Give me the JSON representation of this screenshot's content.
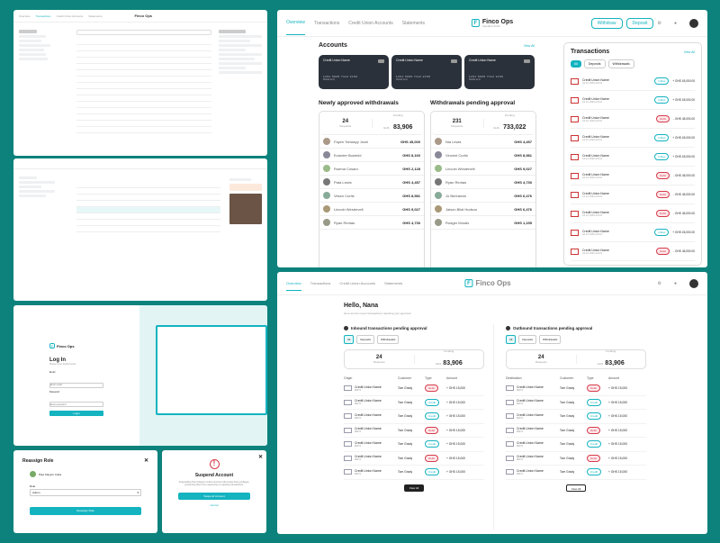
{
  "brand": {
    "name": "Finco Ops",
    "tagline": "Operations Portal"
  },
  "nav": {
    "overview": "Overview",
    "transactions": "Transactions",
    "credit_union": "Credit Union Accounts",
    "statements": "Statements"
  },
  "top_right": {
    "withdraw_label": "Withdraw",
    "deposit_label": "Deposit"
  },
  "accounts": {
    "title": "Accounts",
    "view_all": "View All",
    "cards": [
      {
        "name": "Credit Union Name",
        "number": "1251 5965 7112 2156",
        "type": "Mobile Acct"
      },
      {
        "name": "Credit Union Name",
        "number": "1251 5965 7112 2156",
        "type": "Mobile Acct"
      },
      {
        "name": "Credit Union Name",
        "number": "1251 5965 7112 2156",
        "type": "Mobile Acct"
      }
    ]
  },
  "approved": {
    "title": "Newly approved withdrawals",
    "count": "24",
    "count_label": "Requests",
    "funding_label": "Funding",
    "currency": "GHS",
    "amount": "83,906",
    "rows": [
      {
        "name": "Fayen Tobiasyy Jovel",
        "amount": "GHS 45,000"
      },
      {
        "name": "Evander Bowerld",
        "amount": "GHS 8,160"
      },
      {
        "name": "Ruema Cosaro",
        "amount": "GHS 2,128"
      },
      {
        "name": "Pata Lewis",
        "amount": "GHS 4,457"
      },
      {
        "name": "Vesen Curtis",
        "amount": "GHS 8,981"
      },
      {
        "name": "Lincoln Westervelt",
        "amount": "GHS 9,027"
      },
      {
        "name": "Ryan Rentas",
        "amount": "GHS 4,730"
      }
    ]
  },
  "pending": {
    "title": "Withdrawals pending approval",
    "count": "231",
    "count_label": "Requests",
    "funding_label": "Funding",
    "currency": "GHS",
    "amount": "733,022",
    "rows": [
      {
        "name": "Nia Lewis",
        "amount": "GHS 4,457"
      },
      {
        "name": "Vincent Curtis",
        "amount": "GHS 8,981"
      },
      {
        "name": "Lincoln Westervelt",
        "amount": "GHS 9,027"
      },
      {
        "name": "Ryan Rentas",
        "amount": "GHS 4,730"
      },
      {
        "name": "Jo Bereanda",
        "amount": "GHS 6,476"
      },
      {
        "name": "Jaison Bilal Hudson",
        "amount": "GHS 6,476"
      },
      {
        "name": "Rodger Morals",
        "amount": "GHS 1,155"
      }
    ]
  },
  "transactions": {
    "title": "Transactions",
    "view_all": "View All",
    "filters": [
      "All",
      "Deposits",
      "Withdrawals"
    ],
    "rows": [
      {
        "bank": "Credit Union Name",
        "date": "Jul 14, 2023 at 9:41",
        "type": "Inflow",
        "amount": "+ GHS 45,000.00"
      },
      {
        "bank": "Credit Union Name",
        "date": "Jul 14, 2023 at 9:41",
        "type": "Inflow",
        "amount": "+ GHS 45,000.00"
      },
      {
        "bank": "Credit Union Name",
        "date": "Jul 14, 2023 at 9:41",
        "type": "Debit",
        "amount": "- GHS 45,000.00"
      },
      {
        "bank": "Credit Union Name",
        "date": "Jul 14, 2023 at 9:41",
        "type": "Inflow",
        "amount": "+ GHS 45,000.00"
      },
      {
        "bank": "Credit Union Name",
        "date": "Jul 14, 2023 at 9:41",
        "type": "Inflow",
        "amount": "+ GHS 45,000.00"
      },
      {
        "bank": "Credit Union Name",
        "date": "Jul 14, 2023 at 9:41",
        "type": "Debit",
        "amount": "- GHS 45,000.00"
      },
      {
        "bank": "Credit Union Name",
        "date": "Jul 14, 2023 at 9:41",
        "type": "Debit",
        "amount": "- GHS 45,000.00"
      },
      {
        "bank": "Credit Union Name",
        "date": "Jul 14, 2023 at 9:41",
        "type": "Debit",
        "amount": "- GHS 45,000.00"
      },
      {
        "bank": "Credit Union Name",
        "date": "Jul 14, 2023 at 9:41",
        "type": "Inflow",
        "amount": "+ GHS 45,000.00"
      },
      {
        "bank": "Credit Union Name",
        "date": "Jul 14, 2023 at 9:41",
        "type": "Debit",
        "amount": "- GHS 45,000.00"
      }
    ]
  },
  "hello": {
    "greeting": "Hello, Nana",
    "subtitle": "Here are the recent transactions requiring your approval"
  },
  "inbound": {
    "title": "Inbound transactions pending approval",
    "filters": [
      "All",
      "Deposits",
      "Withdrawals"
    ],
    "count": "24",
    "count_label": "Requests",
    "funding_label": "Funding",
    "currency": "GHS",
    "amount": "83,906",
    "columns": [
      "Origin",
      "Customer",
      "Type",
      "Amount"
    ],
    "rows": [
      {
        "origin": "Credit Union Name",
        "code": "#E871",
        "customer": "Tom Grady",
        "type": "Debit",
        "amount": "+ GHS 15,000"
      },
      {
        "origin": "Credit Union Name",
        "code": "#E871",
        "customer": "Tom Grady",
        "type": "Credit",
        "amount": "+ GHS 15,000"
      },
      {
        "origin": "Credit Union Name",
        "code": "#E871",
        "customer": "Tom Grady",
        "type": "Credit",
        "amount": "+ GHS 15,000"
      },
      {
        "origin": "Credit Union Name",
        "code": "#E871",
        "customer": "Tom Grady",
        "type": "Debit",
        "amount": "+ GHS 15,000"
      },
      {
        "origin": "Credit Union Name",
        "code": "#E871",
        "customer": "Tom Grady",
        "type": "Credit",
        "amount": "+ GHS 15,000"
      },
      {
        "origin": "Credit Union Name",
        "code": "#E871",
        "customer": "Tom Grady",
        "type": "Debit",
        "amount": "+ GHS 15,000"
      },
      {
        "origin": "Credit Union Name",
        "code": "#E871",
        "customer": "Tom Grady",
        "type": "Credit",
        "amount": "+ GHS 15,000"
      }
    ],
    "view_all": "View All"
  },
  "outbound": {
    "title": "Outbound transactions pending approval",
    "filters": [
      "All",
      "Deposits",
      "Withdrawals"
    ],
    "count": "24",
    "count_label": "Requests",
    "funding_label": "Funding",
    "currency": "GHS",
    "amount": "83,906",
    "columns": [
      "Destination",
      "Customer",
      "Type",
      "Amount"
    ],
    "rows": [
      {
        "origin": "Credit Union Name",
        "code": "#E871",
        "customer": "Tom Grady",
        "type": "Debit",
        "amount": "+ GHS 15,000"
      },
      {
        "origin": "Credit Union Name",
        "code": "#E871",
        "customer": "Tom Grady",
        "type": "Credit",
        "amount": "+ GHS 15,000"
      },
      {
        "origin": "Credit Union Name",
        "code": "#E871",
        "customer": "Tom Grady",
        "type": "Credit",
        "amount": "+ GHS 15,000"
      },
      {
        "origin": "Credit Union Name",
        "code": "#E871",
        "customer": "Tom Grady",
        "type": "Debit",
        "amount": "+ GHS 15,000"
      },
      {
        "origin": "Credit Union Name",
        "code": "#E871",
        "customer": "Tom Grady",
        "type": "Credit",
        "amount": "+ GHS 15,000"
      },
      {
        "origin": "Credit Union Name",
        "code": "#E871",
        "customer": "Tom Grady",
        "type": "Debit",
        "amount": "+ GHS 15,000"
      },
      {
        "origin": "Credit Union Name",
        "code": "#E871",
        "customer": "Tom Grady",
        "type": "Credit",
        "amount": "+ GHS 15,000"
      }
    ],
    "view_all": "View All"
  },
  "login": {
    "title": "Log In",
    "subtitle": "Please enter details below",
    "email_label": "Email",
    "email_placeholder": "Enter email",
    "password_label": "Password",
    "password_placeholder": "Enter password",
    "button": "Login"
  },
  "reassign": {
    "title": "Reassign Role",
    "name": "Paul Clayton Cuba",
    "role_label": "Role",
    "role_value": "Admin",
    "button": "Reassign Role"
  },
  "suspend": {
    "title": "Suspend Account",
    "body": "Suspending Paul Clayton Cuba's account will revoke their privileges, preventing them from approving or rejecting transactions.",
    "confirm": "Suspend Account",
    "cancel": "Cancel"
  },
  "colors": {
    "accent": "#14b3c0",
    "background": "#0d827c",
    "card": "#2b313a",
    "debit": "#d63a4a"
  }
}
